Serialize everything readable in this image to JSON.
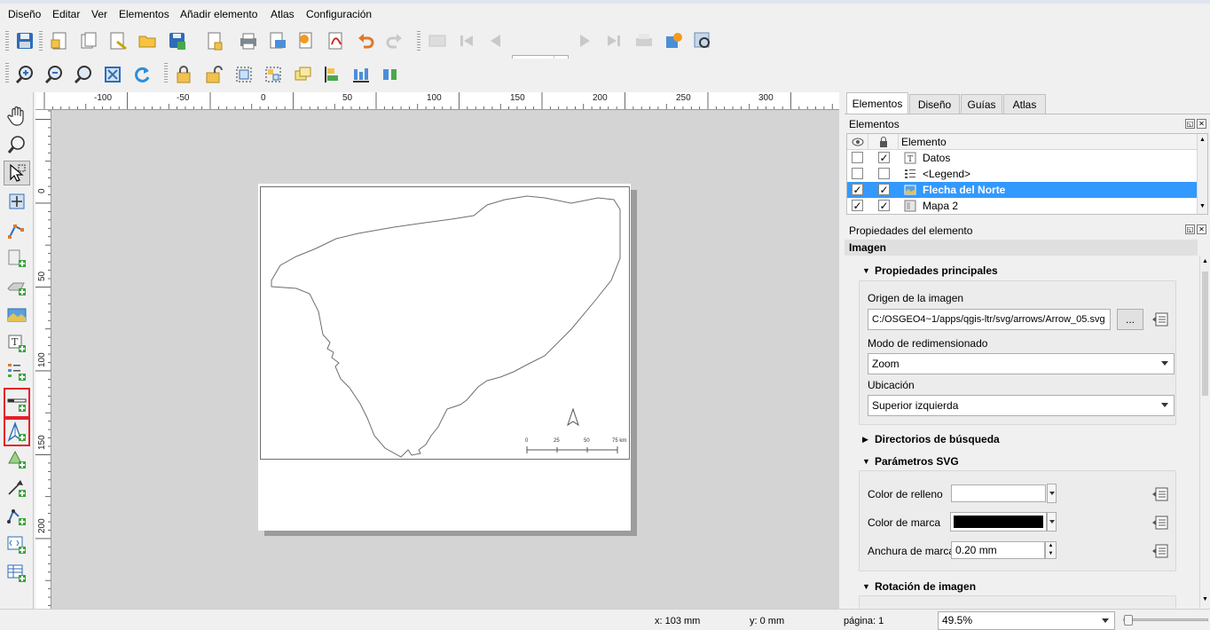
{
  "menu": [
    "Diseño",
    "Editar",
    "Ver",
    "Elementos",
    "Añadir elemento",
    "Atlas",
    "Configuración"
  ],
  "atlas_page_spin": {
    "value": "1"
  },
  "ruler_h_labels": [
    "-100",
    "-50",
    "0",
    "50",
    "100",
    "150",
    "200",
    "250",
    "300"
  ],
  "ruler_v_labels": [
    "0",
    "50",
    "100",
    "150",
    "200"
  ],
  "map": {
    "scalebar_labels": [
      "0",
      "25",
      "50",
      "75 km"
    ],
    "colors": {
      "outline": "#6e6e6e",
      "paper": "#ffffff",
      "canvas_bg": "#d4d4d4"
    }
  },
  "dock": {
    "tabs": [
      "Elementos",
      "Diseño",
      "Guías",
      "Atlas"
    ],
    "active_tab": "Elementos",
    "items_panel": {
      "title": "Elementos",
      "column_header": "Elemento",
      "rows": [
        {
          "visible": false,
          "locked": true,
          "icon": "text-icon",
          "label": "Datos",
          "selected": false
        },
        {
          "visible": false,
          "locked": false,
          "icon": "legend-icon",
          "label": "<Legend>",
          "selected": false
        },
        {
          "visible": true,
          "locked": true,
          "icon": "picture-icon",
          "label": "Flecha del Norte",
          "selected": true
        },
        {
          "visible": true,
          "locked": true,
          "icon": "map-icon",
          "label": "Mapa 2",
          "selected": false
        }
      ]
    },
    "properties": {
      "title": "Propiedades del elemento",
      "item_type": "Imagen",
      "main_section": "Propiedades principales",
      "image_source_label": "Origen de la imagen",
      "image_source_value": "C:/OSGEO4~1/apps/qgis-ltr/svg/arrows/Arrow_05.svg",
      "browse_button": "...",
      "resize_mode_label": "Modo de redimensionado",
      "resize_mode_value": "Zoom",
      "placement_label": "Ubicación",
      "placement_value": "Superior izquierda",
      "search_dirs_section": "Directorios de búsqueda",
      "svg_params_section": "Parámetros SVG",
      "fill_color_label": "Color de relleno",
      "fill_color": "#ffffff",
      "stroke_color_label": "Color de marca",
      "stroke_color": "#000000",
      "stroke_width_label": "Anchura de marca",
      "stroke_width_value": "0.20 mm",
      "rotation_section": "Rotación de imagen"
    }
  },
  "status": {
    "x": "x: 103 mm",
    "y": "y: 0 mm",
    "page": "página: 1",
    "zoom": "49.5%"
  },
  "colors": {
    "selection": "#3399ff",
    "highlight_box": "#e4202a"
  }
}
